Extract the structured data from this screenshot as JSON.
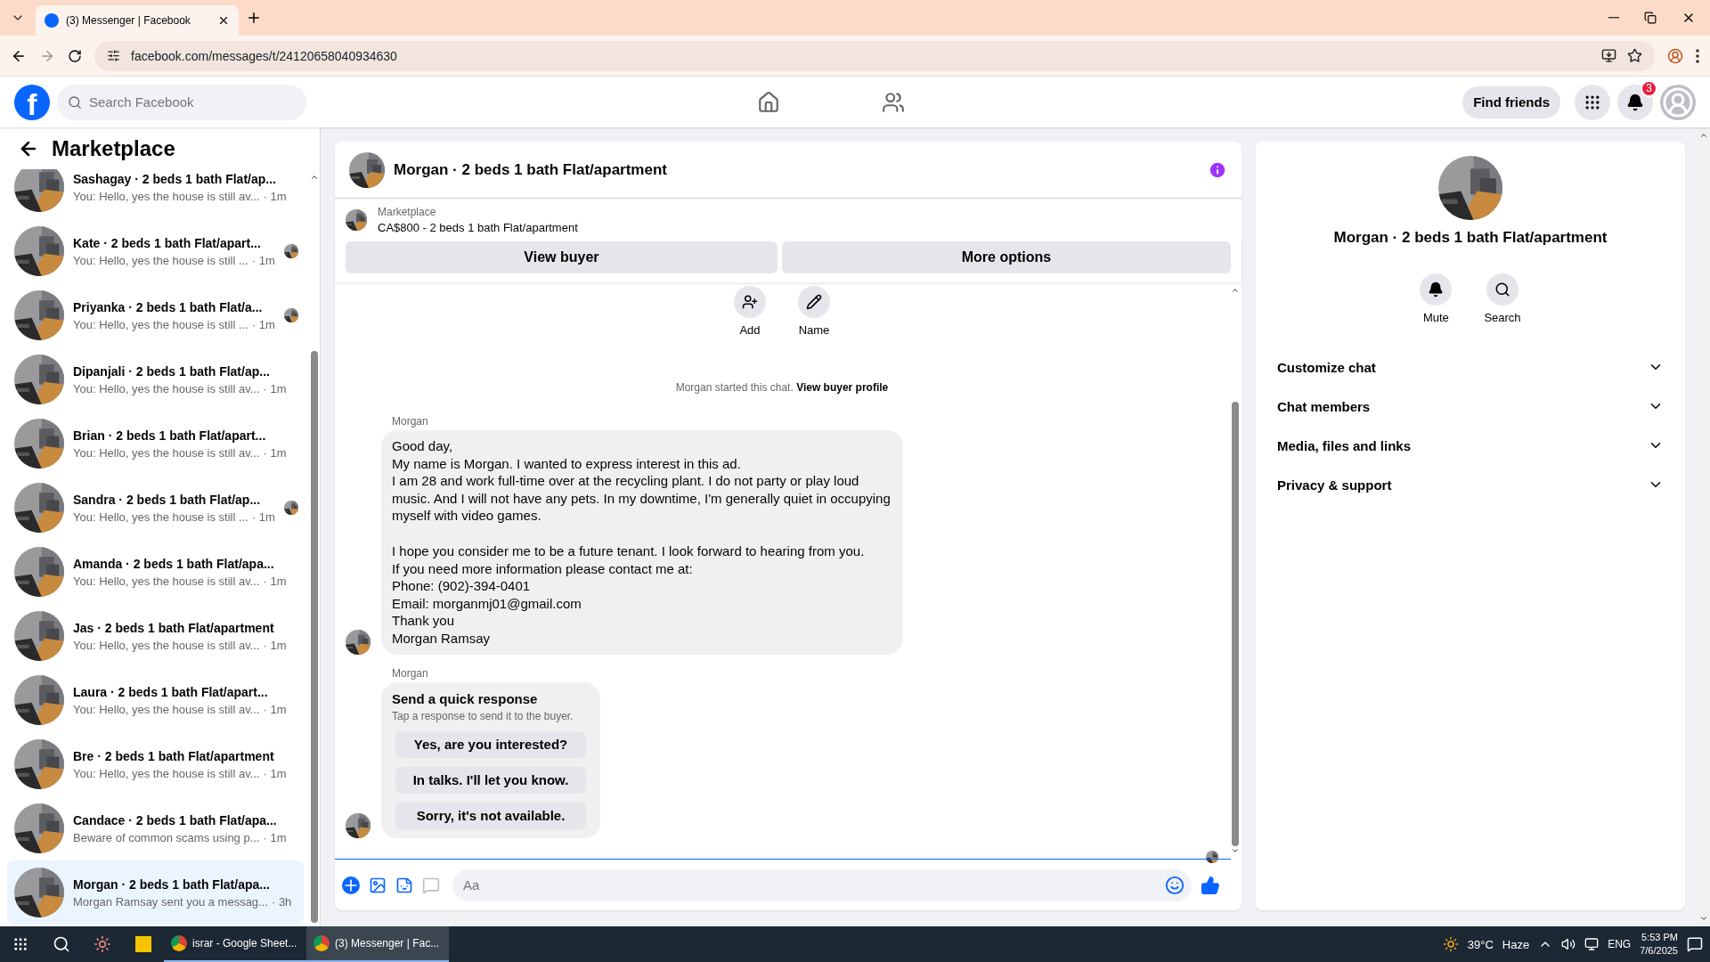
{
  "browser": {
    "tabs": [
      {
        "title": "(3) Messenger | Facebook",
        "selected": true
      }
    ],
    "url": "facebook.com/messages/t/24120658040934630"
  },
  "header": {
    "logo_letter": "f",
    "search": {
      "placeholder": "Search Facebook"
    },
    "find_friends": "Find friends",
    "notification_count": "3"
  },
  "sidebar": {
    "title": "Marketplace",
    "conversations": [
      {
        "title": "Sashagay · 2 beds 1 bath Flat/ap...",
        "preview": "You: Hello, yes the house is still av...",
        "time": "· 1m",
        "selected": false,
        "seen": false
      },
      {
        "title": "Kate · 2 beds 1 bath Flat/apart...",
        "preview": "You: Hello, yes the house is still ...",
        "time": "· 1m",
        "selected": false,
        "seen": true
      },
      {
        "title": "Priyanka · 2 beds 1 bath Flat/a...",
        "preview": "You: Hello, yes the house is still ...",
        "time": "· 1m",
        "selected": false,
        "seen": true
      },
      {
        "title": "Dipanjali · 2 beds 1 bath Flat/ap...",
        "preview": "You: Hello, yes the house is still av...",
        "time": "· 1m",
        "selected": false,
        "seen": false
      },
      {
        "title": "Brian · 2 beds 1 bath Flat/apart...",
        "preview": "You: Hello, yes the house is still av...",
        "time": "· 1m",
        "selected": false,
        "seen": false
      },
      {
        "title": "Sandra · 2 beds 1 bath Flat/ap...",
        "preview": "You: Hello, yes the house is still ...",
        "time": "· 1m",
        "selected": false,
        "seen": true
      },
      {
        "title": "Amanda · 2 beds 1 bath Flat/apa...",
        "preview": "You: Hello, yes the house is still av...",
        "time": "· 1m",
        "selected": false,
        "seen": false
      },
      {
        "title": "Jas · 2 beds 1 bath Flat/apartment",
        "preview": "You: Hello, yes the house is still av...",
        "time": "· 1m",
        "selected": false,
        "seen": false
      },
      {
        "title": "Laura · 2 beds 1 bath Flat/apart...",
        "preview": "You: Hello, yes the house is still av...",
        "time": "· 1m",
        "selected": false,
        "seen": false
      },
      {
        "title": "Bre · 2 beds 1 bath Flat/apartment",
        "preview": "You: Hello, yes the house is still av...",
        "time": "· 1m",
        "selected": false,
        "seen": false
      },
      {
        "title": "Candace · 2 beds 1 bath Flat/apa...",
        "preview": "Beware of common scams using p...",
        "time": "· 1m",
        "selected": false,
        "seen": false
      },
      {
        "title": "Morgan · 2 beds 1 bath Flat/apa...",
        "preview": "Morgan Ramsay sent you a messag...",
        "time": "· 3h",
        "selected": true,
        "seen": false
      }
    ]
  },
  "chat": {
    "title": "Morgan · 2 beds 1 bath Flat/apartment",
    "listing": {
      "source": "Marketplace",
      "title": "CA$800 - 2 beds 1 bath Flat/apartment"
    },
    "buttons": [
      "View buyer",
      "More options"
    ],
    "actions": [
      {
        "kind": "add",
        "label": "Add"
      },
      {
        "kind": "name",
        "label": "Name"
      }
    ],
    "note": {
      "text": "Morgan started this chat.",
      "link": "View buyer profile"
    },
    "messages": [
      {
        "kind": "text",
        "sender": "Morgan",
        "paragraphs": [
          "Good day,\nMy name is Morgan. I wanted to express interest in this ad.\nI am 28 and work full-time over at the recycling plant. I do not party or play loud music. And I will not have any pets. In my downtime, I'm generally quiet in occupying myself with video games.",
          "I hope you consider me to be a future tenant. I look forward to hearing from you.\nIf you need more information please contact me at:\nPhone: (902)-394-0401\nEmail: morganmj01@gmail.com\nThank you\nMorgan Ramsay"
        ]
      },
      {
        "kind": "quick_response",
        "sender": "Morgan",
        "title": "Send a quick response",
        "subtitle": "Tap a response to send it to the buyer.",
        "options": [
          "Yes, are you interested?",
          "In talks. I'll let you know.",
          "Sorry, it's not available."
        ]
      }
    ],
    "composer": {
      "placeholder": "Aa"
    }
  },
  "details": {
    "title": "Morgan · 2 beds 1 bath Flat/apartment",
    "actions": [
      {
        "kind": "mute",
        "label": "Mute"
      },
      {
        "kind": "search",
        "label": "Search"
      }
    ],
    "sections": [
      {
        "label": "Customize chat",
        "expanded": false
      },
      {
        "label": "Chat members",
        "expanded": false
      },
      {
        "label": "Media, files and links",
        "expanded": false
      },
      {
        "label": "Privacy & support",
        "expanded": false
      }
    ]
  },
  "taskbar": {
    "apps": [
      {
        "label": "israr - Google Sheet...",
        "selected": false
      },
      {
        "label": "(3) Messenger | Fac...",
        "selected": true
      }
    ],
    "weather": {
      "temp": "39°C",
      "condition": "Haze"
    },
    "language": "ENG",
    "time": "5:53 PM",
    "date": "7/6/2025"
  }
}
